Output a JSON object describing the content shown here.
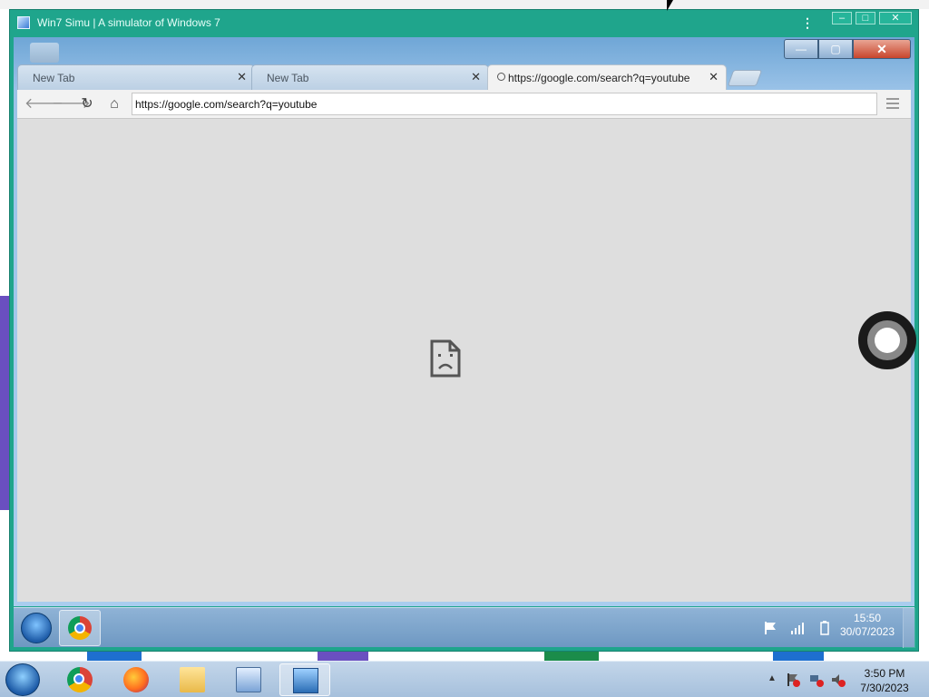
{
  "emulator": {
    "title": "Win7 Simu | A simulator of Windows 7",
    "controls": {
      "minimize": "–",
      "maximize": "□",
      "close": "✕"
    }
  },
  "browser": {
    "window_controls": {
      "minimize": "—",
      "maximize": "▢",
      "close": "✕"
    },
    "tabs": [
      {
        "label": "New Tab",
        "close": "✕",
        "active": false
      },
      {
        "label": "New Tab",
        "close": "✕",
        "active": false
      },
      {
        "label": "https://google.com/search?q=youtube",
        "close": "✕",
        "active": true
      }
    ],
    "nav": {
      "back": "🡐",
      "forward": "🡒",
      "reload": "↻",
      "home": "⌂"
    },
    "address": "https://google.com/search?q=youtube",
    "content_state": "sad-page-error"
  },
  "inner_taskbar": {
    "time": "15:50",
    "date": "30/07/2023",
    "pinned": [
      "chrome"
    ]
  },
  "host_taskbar": {
    "apps": [
      "chrome",
      "firefox",
      "file-explorer",
      "control-panel",
      "remote-desktop"
    ],
    "time": "3:50 PM",
    "date": "7/30/2023",
    "tray_arrow": "▲"
  }
}
